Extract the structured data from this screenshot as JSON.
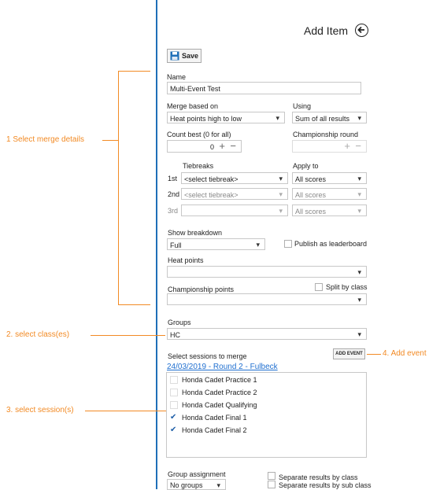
{
  "header": {
    "title": "Add Item",
    "back_icon": "arrow-left-icon"
  },
  "toolbar": {
    "save_label": "Save",
    "save_icon": "floppy-disk-icon"
  },
  "form": {
    "name_label": "Name",
    "name_value": "Multi-Event Test",
    "merge_label": "Merge based on",
    "merge_value": "Heat points high to low",
    "using_label": "Using",
    "using_value": "Sum of all results",
    "count_best_label": "Count best (0 for all)",
    "count_best_value": "0",
    "champ_round_label": "Championship round",
    "tiebreaks_label": "Tiebreaks",
    "apply_to_label": "Apply to",
    "tiebreaks": [
      {
        "rank": "1st",
        "value": "<select tiebreak>",
        "apply": "All scores"
      },
      {
        "rank": "2nd",
        "value": "<select tiebreak>",
        "apply": "All scores"
      },
      {
        "rank": "3rd",
        "value": "",
        "apply": "All scores"
      }
    ],
    "show_breakdown_label": "Show breakdown",
    "show_breakdown_value": "Full",
    "publish_label": "Publish as leaderboard",
    "heat_points_label": "Heat points",
    "champ_points_label": "Championship points",
    "split_label": "Split by class",
    "groups_label": "Groups",
    "groups_value": "HC",
    "select_sessions_label": "Select sessions to merge",
    "add_event_label": "ADD EVENT",
    "session_group": "24/03/2019 - Round 2 - Fulbeck",
    "sessions": [
      {
        "label": "Honda Cadet Practice 1",
        "checked": false
      },
      {
        "label": "Honda Cadet Practice 2",
        "checked": false
      },
      {
        "label": "Honda Cadet Qualifying",
        "checked": false
      },
      {
        "label": "Honda Cadet Final 1",
        "checked": true
      },
      {
        "label": "Honda Cadet Final 2",
        "checked": true
      }
    ],
    "group_assign_label": "Group assignment",
    "group_assign_value": "No groups",
    "sep_class_label": "Separate results by class",
    "sep_subclass_label": "Separate results by sub class"
  },
  "annotations": {
    "a1": "1 Select merge details",
    "a2": "2. select class(es)",
    "a3": "3. select session(s)",
    "a4": "4. Add event",
    "color": "#f28a24"
  }
}
